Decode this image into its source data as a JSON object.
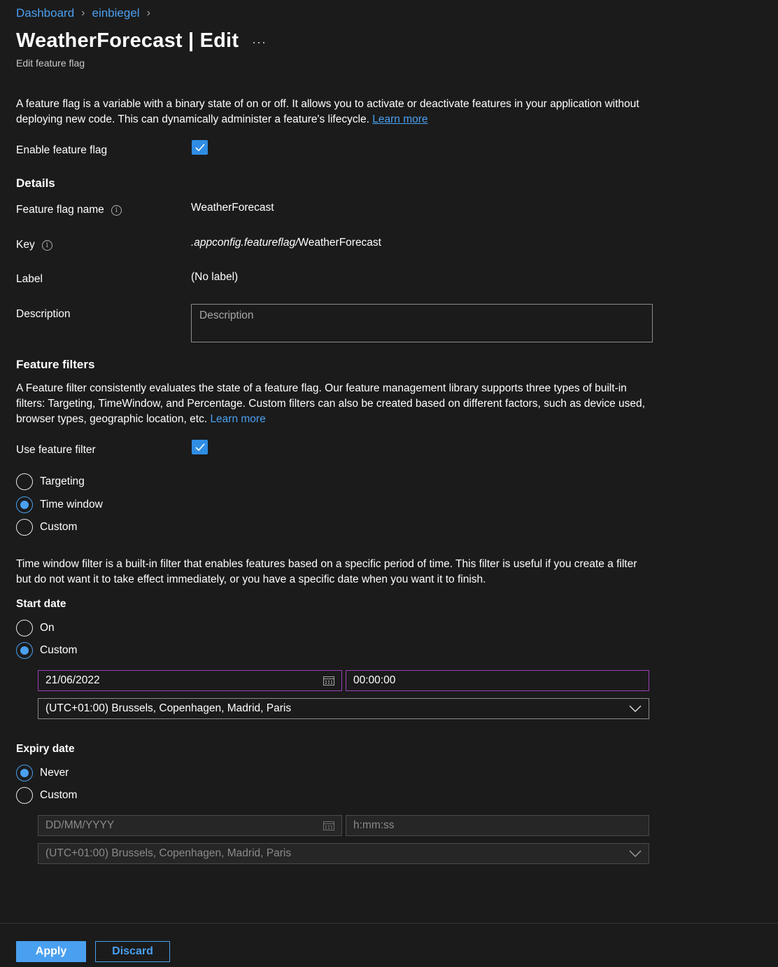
{
  "breadcrumb": {
    "items": [
      "Dashboard",
      "einbiegel"
    ]
  },
  "header": {
    "title": "WeatherForecast | Edit",
    "subtitle": "Edit feature flag",
    "more": "···"
  },
  "intro": {
    "text": "A feature flag is a variable with a binary state of on or off. It allows you to activate or deactivate features in your application without deploying new code. This can dynamically administer a feature's lifecycle.",
    "learn_more": "Learn more"
  },
  "enable_flag": {
    "label": "Enable feature flag",
    "checked": true
  },
  "details": {
    "heading": "Details",
    "name_label": "Feature flag name",
    "name_value": "WeatherForecast",
    "key_label": "Key",
    "key_prefix": ".appconfig.featureflag/",
    "key_value": "WeatherForecast",
    "label_label": "Label",
    "label_value": "(No label)",
    "description_label": "Description",
    "description_placeholder": "Description"
  },
  "filters": {
    "heading": "Feature filters",
    "text": "A Feature filter consistently evaluates the state of a feature flag. Our feature management library supports three types of built-in filters: Targeting, TimeWindow, and Percentage. Custom filters can also be created based on different factors, such as device used, browser types, geographic location, etc.",
    "learn_more": "Learn more",
    "use_label": "Use feature filter",
    "use_checked": true,
    "options": [
      "Targeting",
      "Time window",
      "Custom"
    ],
    "selected": "Time window"
  },
  "time_window": {
    "text": "Time window filter is a built-in filter that enables features based on a specific period of time. This filter is useful if you create a filter but do not want it to take effect immediately, or you have a specific date when you want it to finish."
  },
  "start_date": {
    "heading": "Start date",
    "options": [
      "On",
      "Custom"
    ],
    "selected": "Custom",
    "date": "21/06/2022",
    "time": "00:00:00",
    "timezone": "(UTC+01:00) Brussels, Copenhagen, Madrid, Paris"
  },
  "expiry_date": {
    "heading": "Expiry date",
    "options": [
      "Never",
      "Custom"
    ],
    "selected": "Never",
    "date_placeholder": "DD/MM/YYYY",
    "time_placeholder": "h:mm:ss",
    "timezone": "(UTC+01:00) Brussels, Copenhagen, Madrid, Paris"
  },
  "footer": {
    "apply": "Apply",
    "discard": "Discard"
  },
  "colors": {
    "accent": "#4aa0f0",
    "checkbox": "#2f8de4",
    "focus_border": "#9c3fb8",
    "background": "#1b1b1b"
  }
}
